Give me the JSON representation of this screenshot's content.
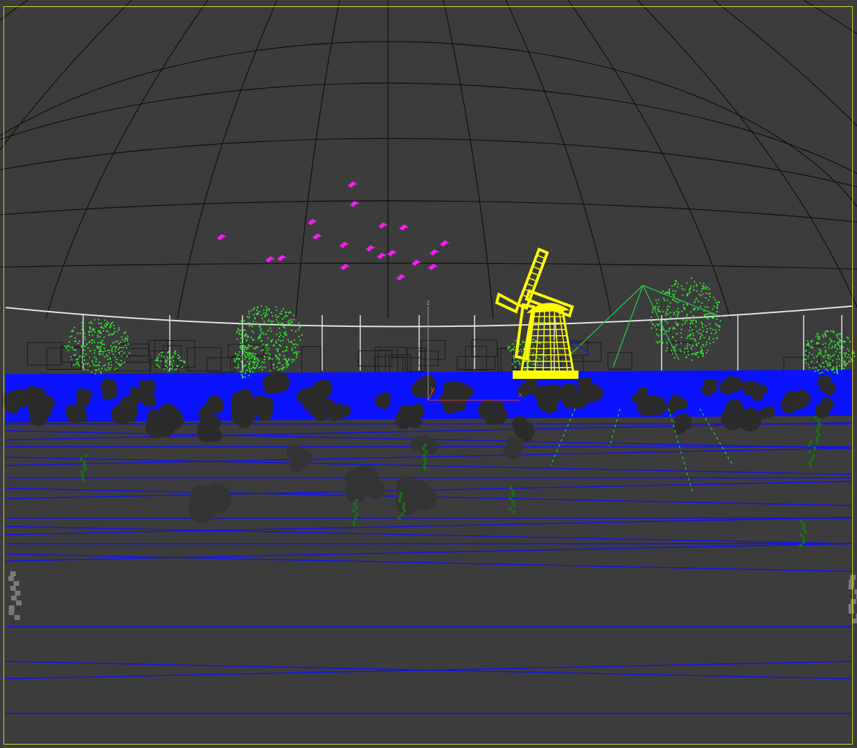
{
  "viewport": {
    "background_color": "#3c3c3c",
    "border_color": "#d8d82a",
    "active": true
  },
  "colors": {
    "dome_grid": "#0d0d0d",
    "fence": "#e6e6e6",
    "fence_dark": "#1a1a1a",
    "ground_lines": "#1010ee",
    "ground_band": "#0a12ff",
    "foliage_selected": "#33e633",
    "foliage_dark": "#2b2b2b",
    "foliage_shadow": "#222222",
    "windmill": "#ffff00",
    "birds": "#ff19ff",
    "light_cone": "#22cc44",
    "gizmo_axis": "#9a9a9a",
    "gizmo_x": "#ff3030"
  },
  "objects": {
    "dome": {
      "icon": "sky-dome-icon"
    },
    "windmill": {
      "icon": "windmill-icon",
      "selected": true
    },
    "birds": {
      "icon": "bird-icon",
      "count": 19
    },
    "trees": {
      "icon": "tree-icon"
    },
    "light": {
      "icon": "spotlight-icon"
    }
  },
  "gizmo": {
    "z_label": "z",
    "y_label": "y",
    "x_label": "x"
  }
}
